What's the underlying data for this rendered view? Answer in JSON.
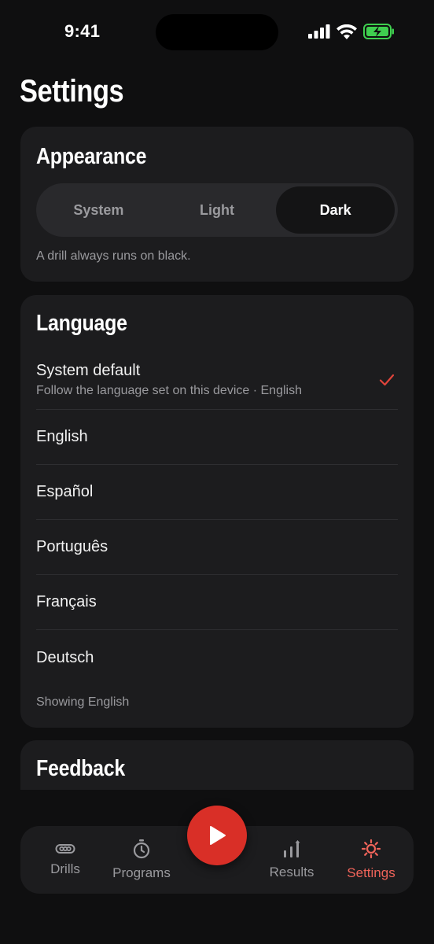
{
  "status": {
    "time": "9:41"
  },
  "page_title": "Settings",
  "appearance": {
    "title": "Appearance",
    "options": [
      "System",
      "Light",
      "Dark"
    ],
    "selected": "Dark",
    "note": "A drill always runs on black."
  },
  "language": {
    "title": "Language",
    "items": [
      {
        "name": "System default",
        "sub": "Follow the language set on this device · English",
        "selected": true
      },
      {
        "name": "English"
      },
      {
        "name": "Español"
      },
      {
        "name": "Português"
      },
      {
        "name": "Français"
      },
      {
        "name": "Deutsch"
      }
    ],
    "note": "Showing English"
  },
  "feedback": {
    "title": "Feedback"
  },
  "tabbar": {
    "tabs": [
      {
        "label": "Drills",
        "icon": "chain-icon"
      },
      {
        "label": "Programs",
        "icon": "stopwatch-icon"
      },
      {
        "label": "Results",
        "icon": "bar-chart-icon"
      },
      {
        "label": "Settings",
        "icon": "gear-icon",
        "active": true
      }
    ],
    "play_icon": "play-icon"
  },
  "colors": {
    "accent": "#d92f27",
    "accent_text": "#f0645a",
    "card": "#1c1c1e",
    "background": "#0f0f10"
  }
}
